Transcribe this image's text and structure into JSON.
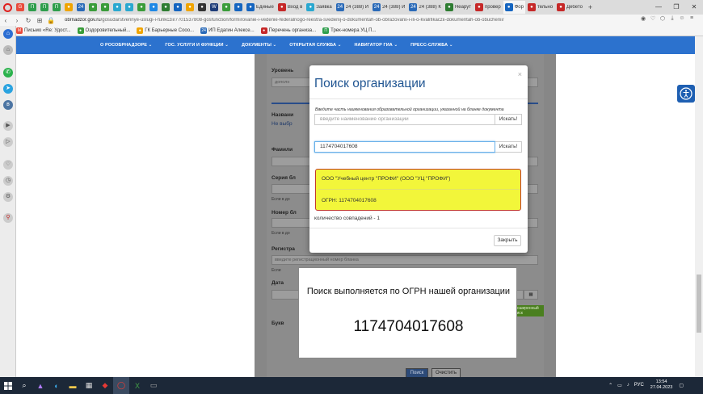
{
  "browser": {
    "tabs": [
      {
        "icon": "G",
        "color": "#e84b3c",
        "label": ""
      },
      {
        "icon": "П",
        "color": "#2e9e4c",
        "label": ""
      },
      {
        "icon": "П",
        "color": "#2e9e4c",
        "label": ""
      },
      {
        "icon": "П",
        "color": "#2e9e4c",
        "label": ""
      },
      {
        "icon": "●",
        "color": "#f0a400",
        "label": ""
      },
      {
        "icon": "24",
        "color": "#2a6ab8",
        "label": ""
      },
      {
        "icon": "●",
        "color": "#3a9c3a",
        "label": ""
      },
      {
        "icon": "●",
        "color": "#3a9c3a",
        "label": ""
      },
      {
        "icon": "●",
        "color": "#2aa8d0",
        "label": ""
      },
      {
        "icon": "●",
        "color": "#2aa8d0",
        "label": ""
      },
      {
        "icon": "●",
        "color": "#3a9c3a",
        "label": ""
      },
      {
        "icon": "●",
        "color": "#1e88e5",
        "label": ""
      },
      {
        "icon": "●",
        "color": "#2e7d32",
        "label": ""
      },
      {
        "icon": "●",
        "color": "#1565c0",
        "label": ""
      },
      {
        "icon": "●",
        "color": "#f0a400",
        "label": ""
      },
      {
        "icon": "●",
        "color": "#333333",
        "label": ""
      },
      {
        "icon": "W",
        "color": "#1e3c78",
        "label": ""
      },
      {
        "icon": "●",
        "color": "#3a9c3a",
        "label": ""
      },
      {
        "icon": "●",
        "color": "#1565c0",
        "label": ""
      },
      {
        "icon": "●",
        "color": "#1565c0",
        "label": "Единые"
      },
      {
        "icon": "●",
        "color": "#c62828",
        "label": "Вход в"
      },
      {
        "icon": "●",
        "color": "#2aa8d0",
        "label": "Заявка"
      },
      {
        "icon": "24",
        "color": "#2a6ab8",
        "label": "24 (388) И"
      },
      {
        "icon": "24",
        "color": "#2a6ab8",
        "label": "24 (388) И"
      },
      {
        "icon": "24",
        "color": "#2a6ab8",
        "label": "24 (388) К"
      },
      {
        "icon": "●",
        "color": "#2e7d32",
        "label": "Неарут"
      },
      {
        "icon": "●",
        "color": "#c62828",
        "label": "провер"
      },
      {
        "icon": "●",
        "color": "#1565c0",
        "label": "Фор"
      },
      {
        "icon": "●",
        "color": "#c62828",
        "label": "тельно"
      },
      {
        "icon": "●",
        "color": "#c62828",
        "label": "Дебето"
      }
    ],
    "url_domain": "obrnadzor.gov.ru",
    "url_path": "/gosudarstvennye-uslugi-i-funkczii/7701537808-gosfunction/formirovanie-i-vedenie-federalnogo-reestra-svedenij-o-dokumentah-ob-obrazovanii-i-ili-o-kvalifikaczii-dokumentah-ob-obuchenii/",
    "bookmarks": [
      {
        "icon": "M",
        "color": "#e84b3c",
        "label": "Письмо «Re: Удост..."
      },
      {
        "icon": "●",
        "color": "#3a9c3a",
        "label": "Оздоровительный..."
      },
      {
        "icon": "●",
        "color": "#f0a400",
        "label": "ГК Барьерные Сооо..."
      },
      {
        "icon": "24",
        "color": "#2a6ab8",
        "label": "ИП Едагин Алексе..."
      },
      {
        "icon": "●",
        "color": "#c62828",
        "label": "Перечень организа..."
      },
      {
        "icon": "П",
        "color": "#2e9e4c",
        "label": "Трек-номера УЦ П..."
      }
    ]
  },
  "site_nav": [
    "О РОСОБРНАДЗОРЕ ⌄",
    "ГОС. УСЛУГИ И ФУНКЦИИ ⌄",
    "ДОКУМЕНТЫ ⌄",
    "ОТКРЫТАЯ СЛУЖБА ⌄",
    "НАВИГАТОР ГИА ⌄",
    "ПРЕСС-СЛУЖБА ⌄"
  ],
  "background_form": {
    "level_label": "Уровень",
    "level_value": "дополн",
    "name_label": "Названи",
    "name_value": "Не выбр",
    "surname_label": "Фамили",
    "series_label": "Серия бл",
    "series_hint": "Если в до",
    "number_label": "Номер бл",
    "number_hint": "Если в до",
    "reg_label": "Регистра",
    "reg_placeholder": "введите регистрационный номер бланка",
    "reg_hint": "Если",
    "date_label": "Дата",
    "ext_search": "Расширенный поиск",
    "letters_label": "Букв",
    "search_btn": "Поиск",
    "clear_btn": "Очистить"
  },
  "modal": {
    "title": "Поиск организации",
    "close": "×",
    "hint": "Введите часть наименования образовательной организации, указанной на бланке документа",
    "name_placeholder": "введите наименование организации",
    "search_btn_1": "Искать!",
    "ogrn_value": "1174704017608",
    "search_btn_2": "Искать!",
    "result_name": "ООО \"Учебный центр \"ПРОФИ\" (ООО \"УЦ \"ПРОФИ\")",
    "result_ogrn": "ОГРН: 1174704017608",
    "count": "количество совпадений - 1",
    "close_btn": "Закрыть"
  },
  "annotation": {
    "text": "Поиск выполняется по ОГРН нашей организации",
    "number": "1174704017608"
  },
  "taskbar": {
    "lang": "РУС",
    "time": "13:54",
    "date": "27.04.2023"
  }
}
